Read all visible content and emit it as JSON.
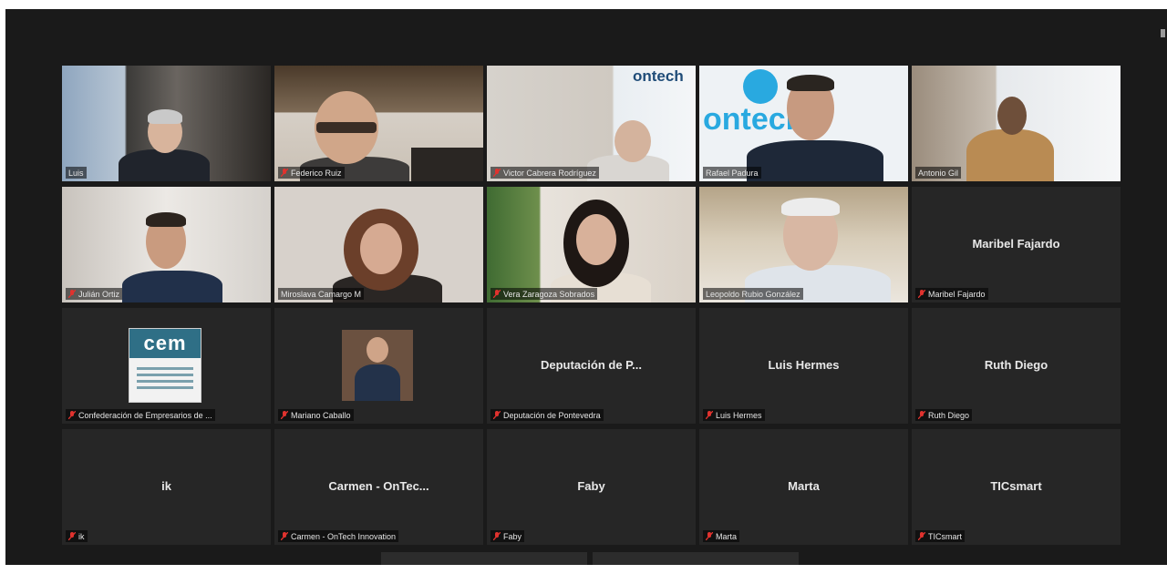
{
  "colors": {
    "window_bg": "#1a1a1a",
    "tile_bg": "#262626",
    "active_speaker_border": "#c9dd45",
    "muted_mic": "#e0322e"
  },
  "participants": [
    {
      "name_label": "Luis",
      "display_name": "",
      "muted": false,
      "video": true
    },
    {
      "name_label": "Federico Ruiz",
      "display_name": "",
      "muted": true,
      "video": true
    },
    {
      "name_label": "Victor Cabrera Rodríguez",
      "display_name": "",
      "muted": true,
      "video": true
    },
    {
      "name_label": "Rafael Padura",
      "display_name": "",
      "muted": false,
      "video": true,
      "active_speaker": true
    },
    {
      "name_label": "Antonio Gil",
      "display_name": "",
      "muted": false,
      "video": true
    },
    {
      "name_label": "Julián Ortiz",
      "display_name": "",
      "muted": true,
      "video": true
    },
    {
      "name_label": "Miroslava Camargo M",
      "display_name": "",
      "muted": false,
      "video": true
    },
    {
      "name_label": "Vera Zaragoza Sobrados",
      "display_name": "",
      "muted": true,
      "video": true
    },
    {
      "name_label": "Leopoldo Rubio González",
      "display_name": "",
      "muted": false,
      "video": true
    },
    {
      "name_label": "Maribel Fajardo",
      "display_name": "Maribel Fajardo",
      "muted": true,
      "video": false
    },
    {
      "name_label": "Confederación de Empresarios de ...",
      "display_name": "",
      "muted": true,
      "video": false,
      "avatar": "cem-logo"
    },
    {
      "name_label": "Mariano Caballo",
      "display_name": "",
      "muted": true,
      "video": false,
      "avatar": "photo"
    },
    {
      "name_label": "Deputación de Pontevedra",
      "display_name": "Deputación de P...",
      "muted": true,
      "video": false
    },
    {
      "name_label": "Luis Hermes",
      "display_name": "Luis Hermes",
      "muted": true,
      "video": false
    },
    {
      "name_label": "Ruth Diego",
      "display_name": "Ruth Diego",
      "muted": true,
      "video": false
    },
    {
      "name_label": "ik",
      "display_name": "ik",
      "muted": true,
      "video": false
    },
    {
      "name_label": "Carmen - OnTech Innovation",
      "display_name": "Carmen - OnTec...",
      "muted": true,
      "video": false
    },
    {
      "name_label": "Faby",
      "display_name": "Faby",
      "muted": true,
      "video": false
    },
    {
      "name_label": "Marta",
      "display_name": "Marta",
      "muted": true,
      "video": false
    },
    {
      "name_label": "TICsmart",
      "display_name": "TICsmart",
      "muted": true,
      "video": false
    }
  ],
  "cem_logo_text": "cem",
  "video_backgrounds": {
    "ontech_banner": "ontech"
  }
}
